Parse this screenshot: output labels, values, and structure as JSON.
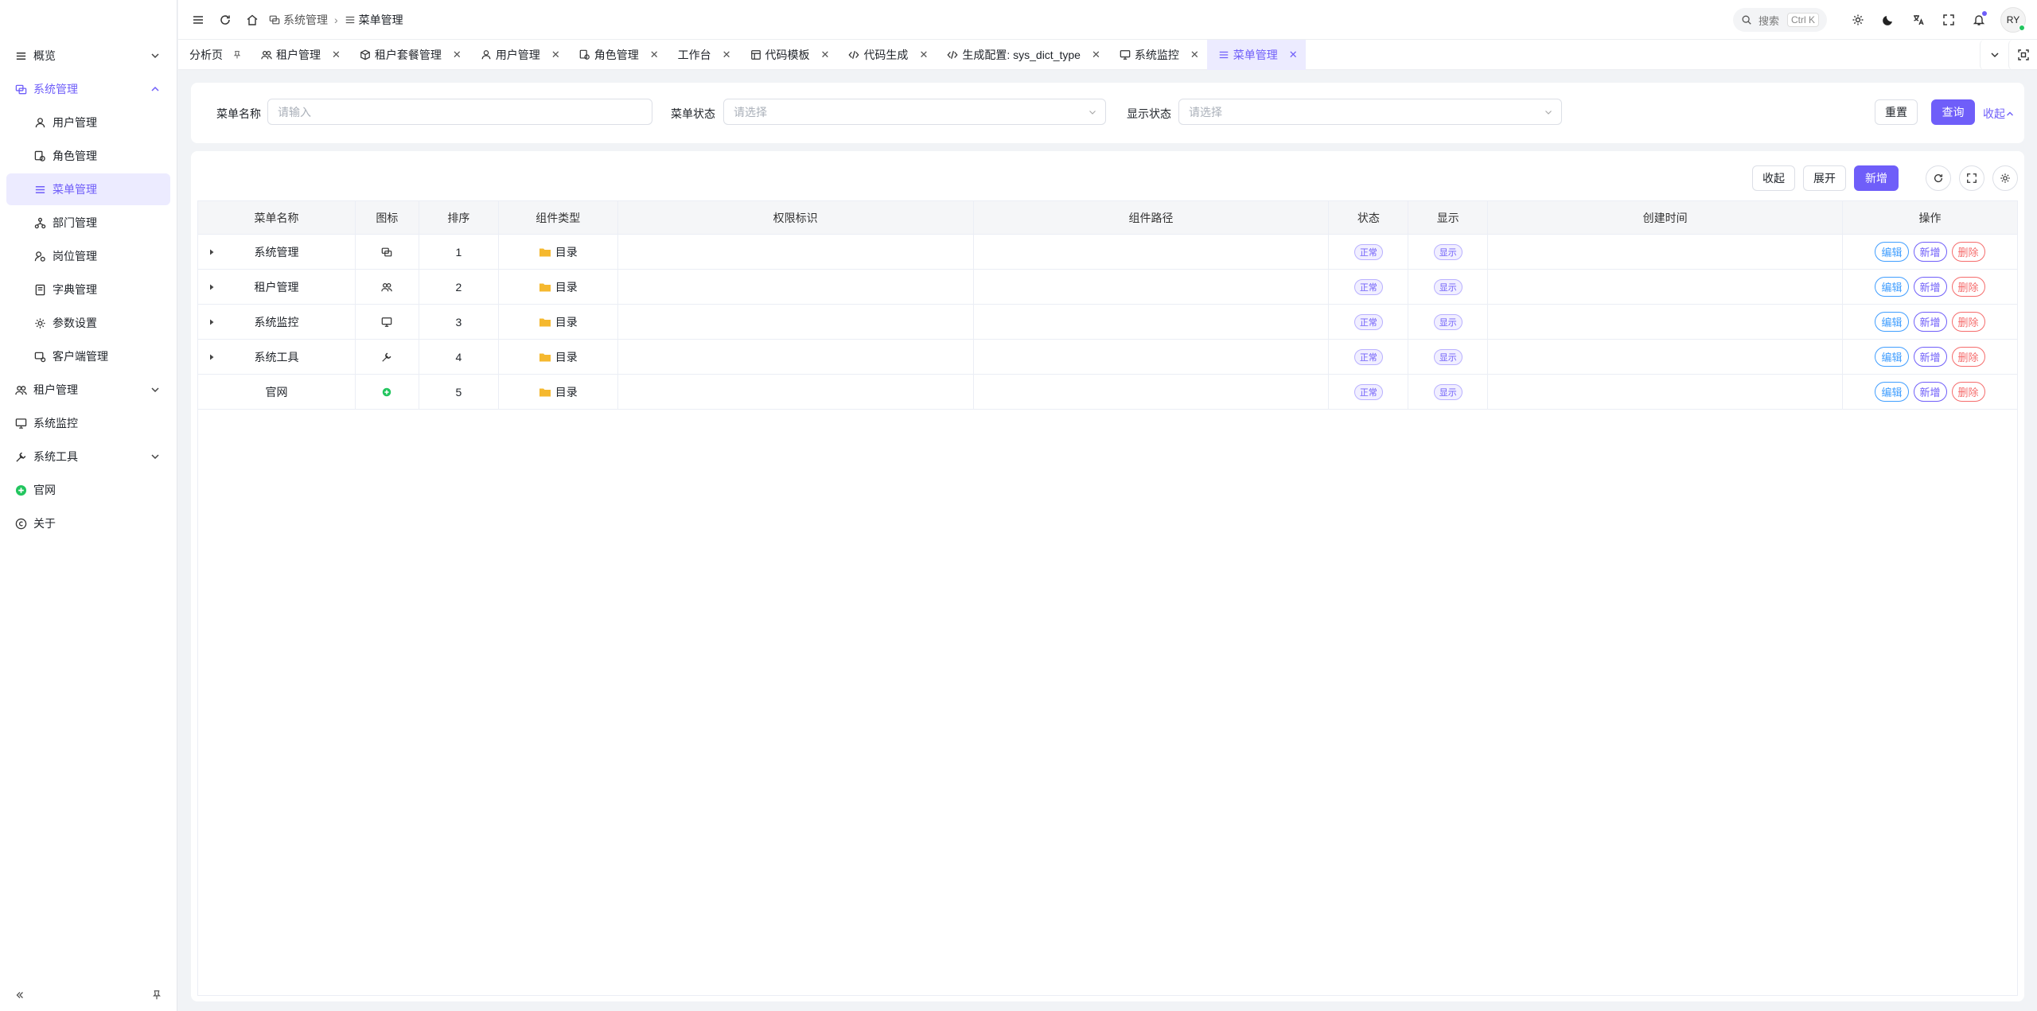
{
  "sidebar": {
    "items": [
      {
        "label": "概览"
      },
      {
        "label": "系统管理"
      },
      {
        "label": "用户管理"
      },
      {
        "label": "角色管理"
      },
      {
        "label": "菜单管理"
      },
      {
        "label": "部门管理"
      },
      {
        "label": "岗位管理"
      },
      {
        "label": "字典管理"
      },
      {
        "label": "参数设置"
      },
      {
        "label": "客户端管理"
      },
      {
        "label": "租户管理"
      },
      {
        "label": "系统监控"
      },
      {
        "label": "系统工具"
      },
      {
        "label": "官网"
      },
      {
        "label": "关于"
      }
    ]
  },
  "header": {
    "breadcrumb": [
      "系统管理",
      "菜单管理"
    ],
    "search_placeholder": "搜索",
    "search_shortcut": "Ctrl K",
    "avatar_text": "RY"
  },
  "tabs": [
    {
      "label": "分析页"
    },
    {
      "label": "租户管理"
    },
    {
      "label": "租户套餐管理"
    },
    {
      "label": "用户管理"
    },
    {
      "label": "角色管理"
    },
    {
      "label": "工作台"
    },
    {
      "label": "代码模板"
    },
    {
      "label": "代码生成"
    },
    {
      "label": "生成配置: sys_dict_type"
    },
    {
      "label": "系统监控"
    },
    {
      "label": "菜单管理"
    }
  ],
  "filters": {
    "menu_name_label": "菜单名称",
    "menu_name_placeholder": "请输入",
    "menu_status_label": "菜单状态",
    "menu_status_placeholder": "请选择",
    "visible_label": "显示状态",
    "visible_placeholder": "请选择",
    "reset_label": "重置",
    "query_label": "查询",
    "collapse_label": "收起"
  },
  "toolbar": {
    "collapse_label": "收起",
    "expand_label": "展开",
    "add_label": "新增"
  },
  "table": {
    "columns": [
      "菜单名称",
      "图标",
      "排序",
      "组件类型",
      "权限标识",
      "组件路径",
      "状态",
      "显示",
      "创建时间",
      "操作"
    ],
    "rows": [
      {
        "name": "系统管理",
        "order": "1",
        "type": "目录",
        "perm": "",
        "path": "",
        "status": "正常",
        "visible": "显示",
        "time": "",
        "icon": "system-icon"
      },
      {
        "name": "租户管理",
        "order": "2",
        "type": "目录",
        "perm": "",
        "path": "",
        "status": "正常",
        "visible": "显示",
        "time": "",
        "icon": "tenant-icon"
      },
      {
        "name": "系统监控",
        "order": "3",
        "type": "目录",
        "perm": "",
        "path": "",
        "status": "正常",
        "visible": "显示",
        "time": "",
        "icon": "monitor-icon"
      },
      {
        "name": "系统工具",
        "order": "4",
        "type": "目录",
        "perm": "",
        "path": "",
        "status": "正常",
        "visible": "显示",
        "time": "",
        "icon": "tool-icon"
      },
      {
        "name": "官网",
        "order": "5",
        "type": "目录",
        "perm": "",
        "path": "",
        "status": "正常",
        "visible": "显示",
        "time": "",
        "icon": "website-icon"
      }
    ],
    "ops": {
      "edit": "编辑",
      "add": "新增",
      "delete": "删除"
    }
  },
  "colors": {
    "accent": "#6f5ef9",
    "edit": "#409eff",
    "delete": "#f56c6c",
    "folder": "#f5b82e",
    "website": "#22c55e"
  }
}
